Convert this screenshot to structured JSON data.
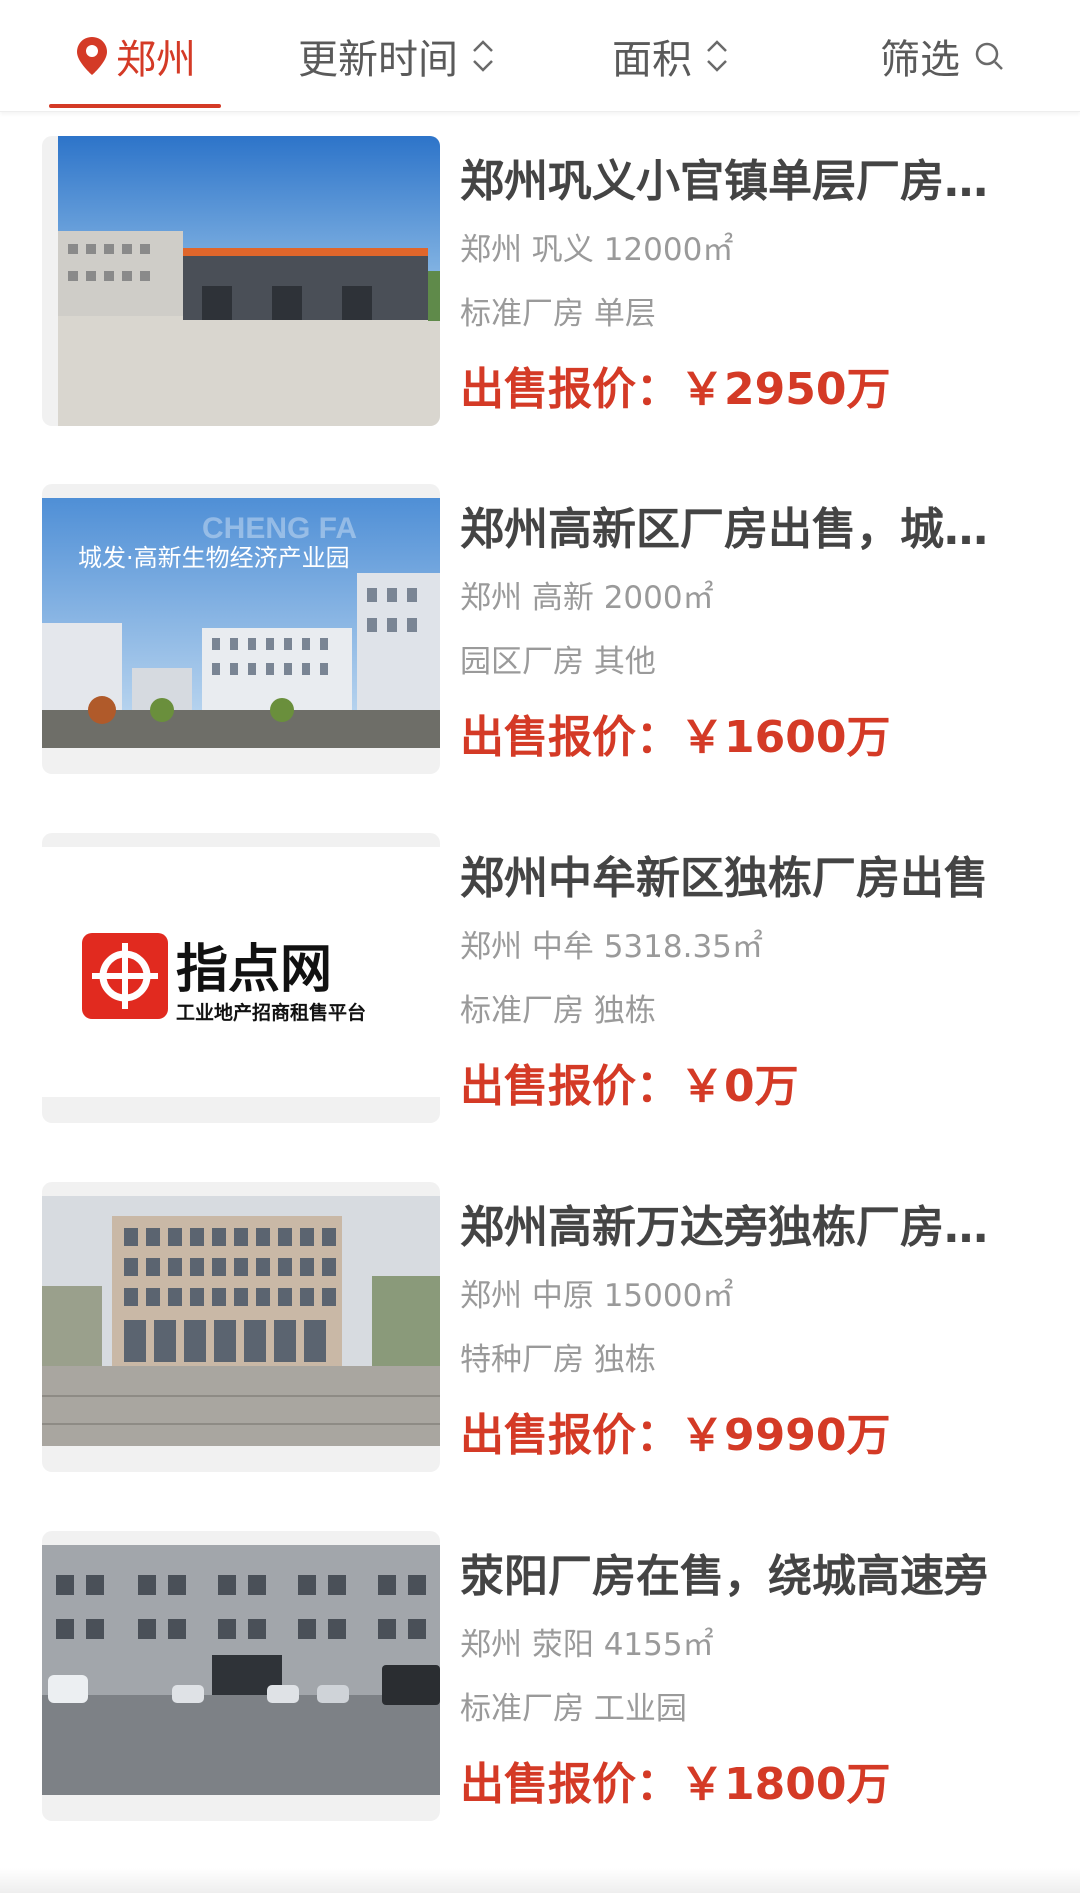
{
  "filter_bar": {
    "city": "郑州",
    "sort_time": "更新时间",
    "sort_area": "面积",
    "filter": "筛选"
  },
  "colors": {
    "accent": "#d43a26",
    "title": "#444444",
    "meta": "#9a9a9a"
  },
  "listings": [
    {
      "title": "郑州巩义小官镇单层厂房出售",
      "location": "郑州 巩义 12000㎡",
      "type": "标准厂房 单层",
      "price_label": "出售报价：",
      "price": "￥2950万",
      "image": "factory-building-photo"
    },
    {
      "title": "郑州高新区厂房出售，城发高新生物经济产业园",
      "location": "郑州 高新 2000㎡",
      "type": "园区厂房 其他",
      "price_label": "出售报价：",
      "price": "￥1600万",
      "image": "industrial-park-photo",
      "image_caption": "城发·高新生物经济产业园",
      "image_watermark": "CHENG FA"
    },
    {
      "title": "郑州中牟新区独栋厂房出售",
      "location": "郑州 中牟 5318.35㎡",
      "type": "标准厂房 独栋",
      "price_label": "出售报价：",
      "price": "￥0万",
      "image": "zhidianwang-logo",
      "logo_name": "指点网",
      "logo_tagline": "工业地产招商租售平台"
    },
    {
      "title": "郑州高新万达旁独栋厂房出售",
      "location": "郑州 中原 15000㎡",
      "type": "特种厂房 独栋",
      "price_label": "出售报价：",
      "price": "￥9990万",
      "image": "office-building-photo"
    },
    {
      "title": "荥阳厂房在售，绕城高速旁",
      "location": "郑州 荥阳 4155㎡",
      "type": "标准厂房 工业园",
      "price_label": "出售报价：",
      "price": "￥1800万",
      "image": "factory-yard-photo"
    }
  ]
}
